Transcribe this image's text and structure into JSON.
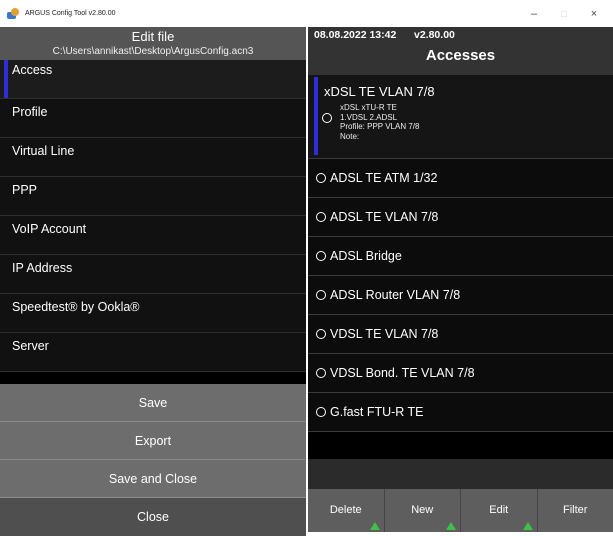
{
  "window": {
    "title": "ARGUS Config Tool v2.80.00",
    "minimize": "–",
    "maximize": "□",
    "close": "×"
  },
  "left": {
    "header_title": "Edit file",
    "header_path": "C:\\Users\\annikast\\Desktop\\ArgusConfig.acn3",
    "menu": [
      {
        "label": "Access"
      },
      {
        "label": "Profile"
      },
      {
        "label": "Virtual Line"
      },
      {
        "label": "PPP"
      },
      {
        "label": "VoIP Account"
      },
      {
        "label": "IP Address"
      },
      {
        "label": "Speedtest® by Ookla®"
      },
      {
        "label": "Server"
      }
    ],
    "buttons": {
      "save": "Save",
      "export": "Export",
      "save_close": "Save and Close",
      "close": "Close"
    }
  },
  "right": {
    "datetime": "08.08.2022 13:42",
    "version": "v2.80.00",
    "title": "Accesses",
    "selected": {
      "title": "xDSL TE VLAN 7/8",
      "line1": "xDSL xTU-R TE",
      "line2": "1.VDSL 2.ADSL",
      "line3": "Profile: PPP VLAN 7/8",
      "line4": "Note:"
    },
    "items": [
      {
        "label": "ADSL TE ATM 1/32"
      },
      {
        "label": "ADSL TE VLAN 7/8"
      },
      {
        "label": "ADSL Bridge"
      },
      {
        "label": "ADSL Router VLAN 7/8"
      },
      {
        "label": "VDSL TE VLAN 7/8"
      },
      {
        "label": "VDSL Bond. TE VLAN 7/8"
      },
      {
        "label": "G.fast FTU-R TE"
      }
    ],
    "toolbar": {
      "delete": "Delete",
      "new": "New",
      "edit": "Edit",
      "filter": "Filter"
    }
  },
  "colors": {
    "selection_bar": "#2e2ed8",
    "arrow_green": "#3ec14a"
  }
}
